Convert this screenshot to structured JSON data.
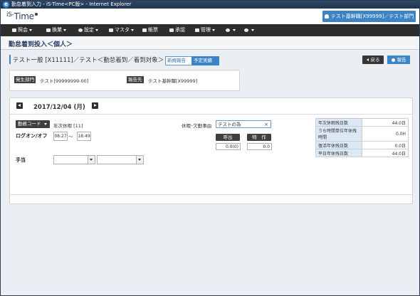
{
  "window": {
    "title": "勤怠着到入力 - iS-Time<PC版> - Internet Explorer",
    "icon": "ie-icon"
  },
  "header": {
    "logo_prefix": "iS-",
    "logo_main": "Time",
    "user_label": "テスト基幹職[X99999]／テスト部門"
  },
  "nav": {
    "items": [
      {
        "label": "照会",
        "icon": "chart-icon",
        "has_caret": true
      },
      {
        "label": "換業",
        "icon": "monitor-icon",
        "has_caret": true
      },
      {
        "label": "設定",
        "icon": "gear-icon",
        "has_caret": true
      },
      {
        "label": "マスタ",
        "icon": "document-icon",
        "has_caret": true
      },
      {
        "label": "帳票",
        "icon": "printer-icon",
        "has_caret": false
      },
      {
        "label": "承認",
        "icon": "check-icon",
        "has_caret": false
      },
      {
        "label": "管理",
        "icon": "grid-icon",
        "has_caret": true
      },
      {
        "label": "",
        "icon": "chat-icon",
        "has_caret": true
      },
      {
        "label": "",
        "icon": "help-icon",
        "has_caret": true
      }
    ]
  },
  "page": {
    "title": "勤怠着到投入＜個人＞"
  },
  "target": {
    "title": "テスト一般 [X11111]／テスト＜勤怠着到／着到対象＞",
    "tag_new": "新規報告",
    "tag_plan": "予定実績"
  },
  "actions": {
    "back": "戻る",
    "report": "報告"
  },
  "info": {
    "dept_label": "発生部門",
    "dept_value": "テスト[99999999-00]",
    "report_label": "報告先",
    "report_value": "テスト基幹職[X99999]"
  },
  "date": {
    "text": "2017/12/04 (月)"
  },
  "form": {
    "work_code_label": "勤務コード",
    "work_code_value": "年次休暇 [11]",
    "logon_label": "ログオン/オフ",
    "logon_start": "08:27",
    "logon_tilde": "〜",
    "logon_end": "18:49",
    "allowance_label": "手当",
    "allowance_select1": "",
    "allowance_select2": "",
    "reason_label": "休暇･欠勤事由",
    "reason_value": "テストの為",
    "call_label": "呼出",
    "special_label": "特　作",
    "call_value": "0.0(0)",
    "special_value": "0.0"
  },
  "leave_balance": [
    {
      "label": "年次休暇残日数",
      "value": "44.0日"
    },
    {
      "label": "うち時間単位年休残時間",
      "value": "0.0H"
    },
    {
      "label": "復活年休残日数",
      "value": "0.0日"
    },
    {
      "label": "平日年休残日数",
      "value": "44.0日"
    }
  ],
  "colors": {
    "accent": "#3d84c6",
    "dark": "#2e2e2e",
    "title": "#2a3e66"
  }
}
